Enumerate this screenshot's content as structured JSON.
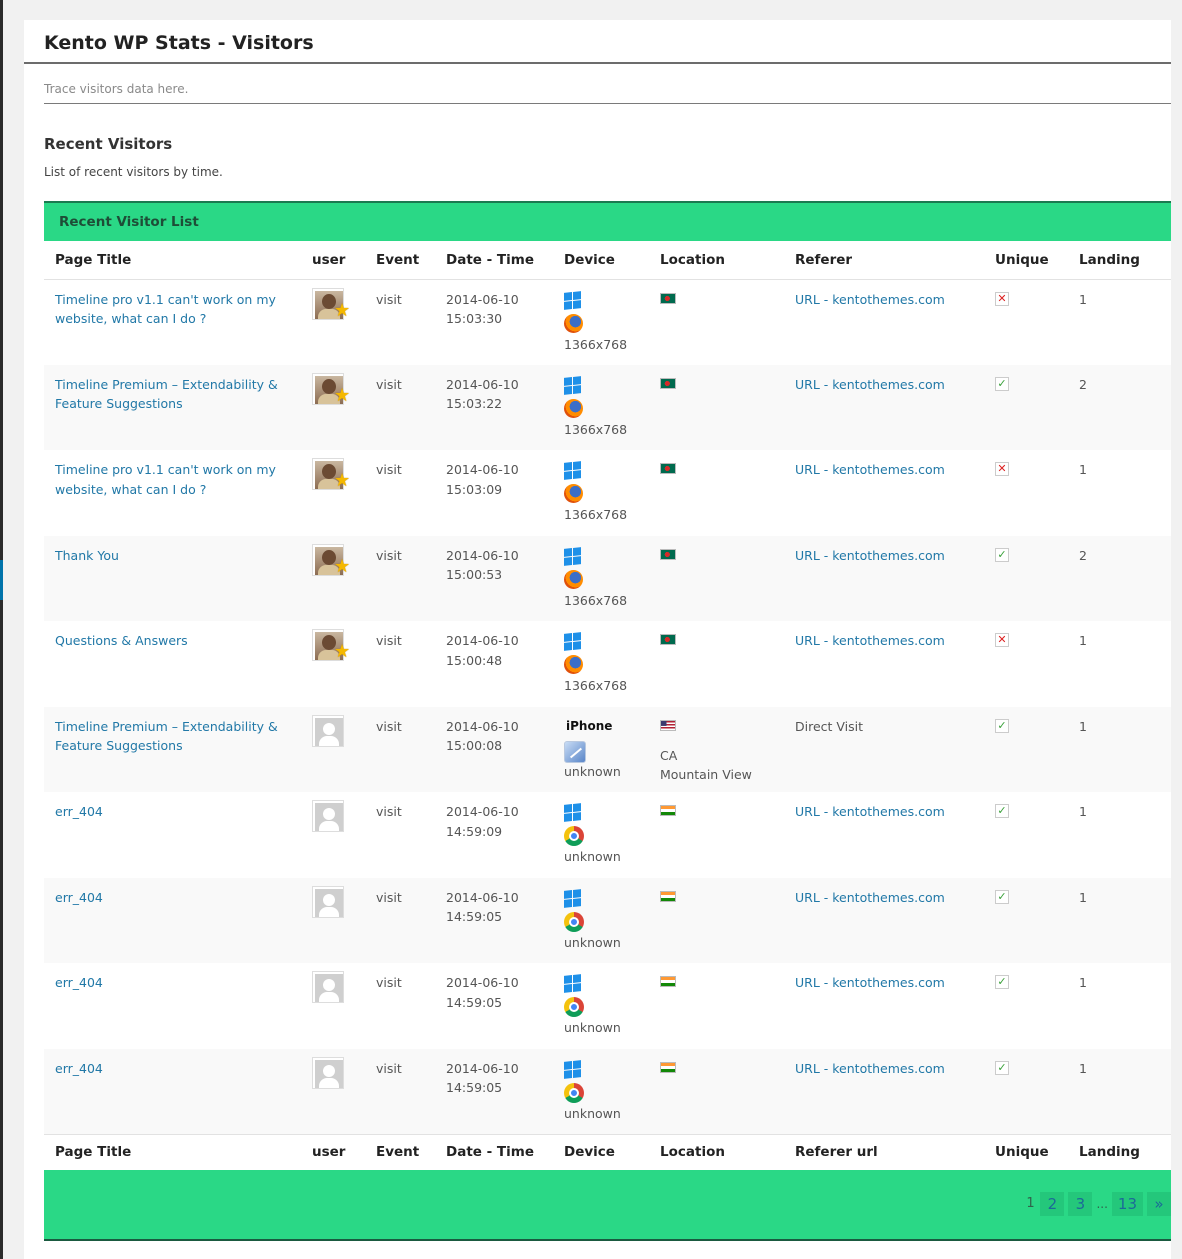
{
  "page": {
    "title": "Kento WP Stats - Visitors",
    "subtitle": "Trace visitors data here.",
    "section_title": "Recent Visitors",
    "section_desc": "List of recent visitors by time.",
    "list_title": "Recent Visitor List"
  },
  "table": {
    "header": [
      "Page Title",
      "user",
      "Event",
      "Date - Time",
      "Device",
      "Location",
      "Referer",
      "Unique",
      "Landing"
    ],
    "footer": [
      "Page Title",
      "user",
      "Event",
      "Date - Time",
      "Device",
      "Location",
      "Referer url",
      "Unique",
      "Landing"
    ],
    "rows": [
      {
        "page_title": "Timeline pro v1.1 can't work on my website, what can I do ?",
        "user_icon": "member-avatar",
        "event": "visit",
        "date": "2014-06-10",
        "time": "15:03:30",
        "os_icon": "windows-icon",
        "browser_icon": "firefox-icon",
        "resolution": "1366x768",
        "flag_icon": "bangladesh-flag-icon",
        "referer": "URL - kentothemes.com",
        "unique": false,
        "landing": "1"
      },
      {
        "page_title": "Timeline Premium – Extendability & Feature Suggestions",
        "user_icon": "member-avatar",
        "event": "visit",
        "date": "2014-06-10",
        "time": "15:03:22",
        "os_icon": "windows-icon",
        "browser_icon": "firefox-icon",
        "resolution": "1366x768",
        "flag_icon": "bangladesh-flag-icon",
        "referer": "URL - kentothemes.com",
        "unique": true,
        "landing": "2"
      },
      {
        "page_title": "Timeline pro v1.1 can't work on my website, what can I do ?",
        "user_icon": "member-avatar",
        "event": "visit",
        "date": "2014-06-10",
        "time": "15:03:09",
        "os_icon": "windows-icon",
        "browser_icon": "firefox-icon",
        "resolution": "1366x768",
        "flag_icon": "bangladesh-flag-icon",
        "referer": "URL - kentothemes.com",
        "unique": false,
        "landing": "1"
      },
      {
        "page_title": "Thank You",
        "user_icon": "member-avatar",
        "event": "visit",
        "date": "2014-06-10",
        "time": "15:00:53",
        "os_icon": "windows-icon",
        "browser_icon": "firefox-icon",
        "resolution": "1366x768",
        "flag_icon": "bangladesh-flag-icon",
        "referer": "URL - kentothemes.com",
        "unique": true,
        "landing": "2"
      },
      {
        "page_title": "Questions & Answers",
        "user_icon": "member-avatar",
        "event": "visit",
        "date": "2014-06-10",
        "time": "15:00:48",
        "os_icon": "windows-icon",
        "browser_icon": "firefox-icon",
        "resolution": "1366x768",
        "flag_icon": "bangladesh-flag-icon",
        "referer": "URL - kentothemes.com",
        "unique": false,
        "landing": "1"
      },
      {
        "page_title": "Timeline Premium – Extendability & Feature Suggestions",
        "user_icon": "default-avatar",
        "event": "visit",
        "date": "2014-06-10",
        "time": "15:00:08",
        "os_icon": "apple-icon",
        "os_label": "iPhone",
        "browser_icon": "safari-icon",
        "resolution": "unknown",
        "flag_icon": "usa-flag-icon",
        "region": "CA",
        "city": "Mountain View",
        "referer": "Direct Visit",
        "unique": true,
        "landing": "1"
      },
      {
        "page_title": "err_404",
        "user_icon": "default-avatar",
        "event": "visit",
        "date": "2014-06-10",
        "time": "14:59:09",
        "os_icon": "windows-icon",
        "browser_icon": "chrome-icon",
        "resolution": "unknown",
        "flag_icon": "india-flag-icon",
        "referer": "URL - kentothemes.com",
        "unique": true,
        "landing": "1"
      },
      {
        "page_title": "err_404",
        "user_icon": "default-avatar",
        "event": "visit",
        "date": "2014-06-10",
        "time": "14:59:05",
        "os_icon": "windows-icon",
        "browser_icon": "chrome-icon",
        "resolution": "unknown",
        "flag_icon": "india-flag-icon",
        "referer": "URL - kentothemes.com",
        "unique": true,
        "landing": "1"
      },
      {
        "page_title": "err_404",
        "user_icon": "default-avatar",
        "event": "visit",
        "date": "2014-06-10",
        "time": "14:59:05",
        "os_icon": "windows-icon",
        "browser_icon": "chrome-icon",
        "resolution": "unknown",
        "flag_icon": "india-flag-icon",
        "referer": "URL - kentothemes.com",
        "unique": true,
        "landing": "1"
      },
      {
        "page_title": "err_404",
        "user_icon": "default-avatar",
        "event": "visit",
        "date": "2014-06-10",
        "time": "14:59:05",
        "os_icon": "windows-icon",
        "browser_icon": "chrome-icon",
        "resolution": "unknown",
        "flag_icon": "india-flag-icon",
        "referer": "URL - kentothemes.com",
        "unique": true,
        "landing": "1"
      }
    ]
  },
  "marks": {
    "unique_yes": "✓",
    "unique_no": "✕"
  },
  "pagination": {
    "current": "1",
    "pages": [
      "2",
      "3"
    ],
    "ellipsis": "...",
    "last": "13",
    "next": "»"
  },
  "colors": {
    "accent_green": "#2ad886",
    "link_blue": "#2178a7"
  }
}
